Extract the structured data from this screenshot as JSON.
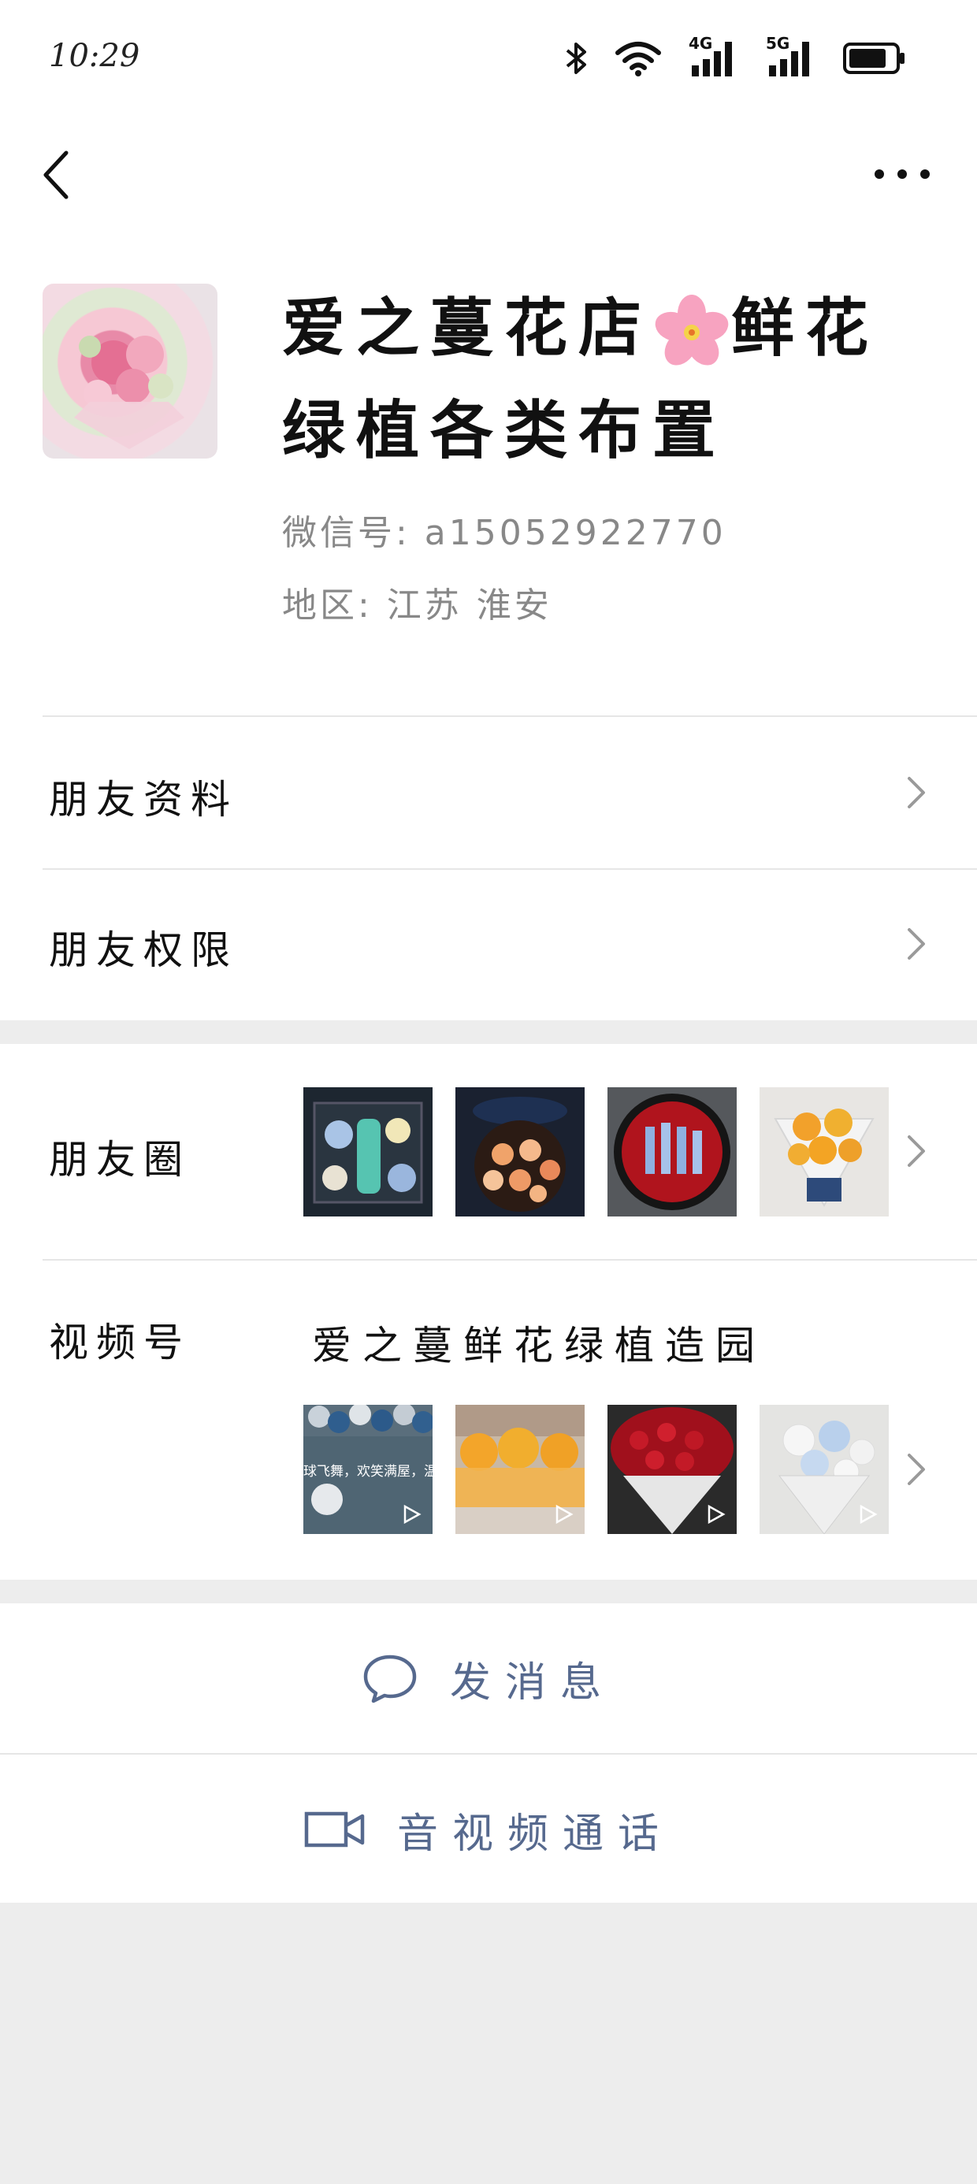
{
  "status_bar": {
    "time": "10:29",
    "network_1": "4G",
    "network_2": "5G"
  },
  "profile": {
    "name_part1": "爱之蔓花店",
    "name_part2": "鲜花绿植各类布置",
    "wechat_id": "微信号: a15052922770",
    "region": "地区: 江苏  淮安",
    "avatar_icon": "bouquet-photo"
  },
  "rows": {
    "friend_profile": "朋友资料",
    "friend_permissions": "朋友权限",
    "moments": "朋友圈",
    "channels": "视频号",
    "channel_name": "爱之蔓鲜花绿植造园"
  },
  "moments_thumbs": [
    "flower-gift-box",
    "orange-roses-box",
    "red-roses-box",
    "sunflower-bouquet"
  ],
  "channel_thumbs": [
    "balloon-decoration",
    "sunflower-stands",
    "red-rose-bouquet",
    "white-blue-bouquet"
  ],
  "channel_thumb_caption": "球飞舞，欢笑满屋，温",
  "actions": {
    "message": "发消息",
    "call": "音视频通话"
  },
  "colors": {
    "action_text": "#56698e",
    "background": "#ededed",
    "card": "#ffffff"
  }
}
